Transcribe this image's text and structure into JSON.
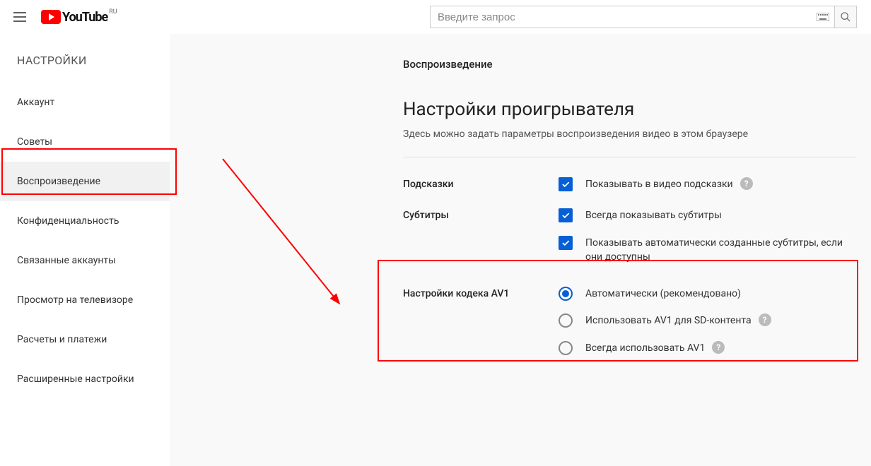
{
  "header": {
    "logo_text": "YouTube",
    "logo_region": "RU",
    "search_placeholder": "Введите запрос"
  },
  "sidebar": {
    "title": "НАСТРОЙКИ",
    "items": [
      "Аккаунт",
      "Советы",
      "Воспроизведение",
      "Конфиденциальность",
      "Связанные аккаунты",
      "Просмотр на телевизоре",
      "Расчеты и платежи",
      "Расширенные настройки"
    ],
    "active_index": 2
  },
  "content": {
    "breadcrumb": "Воспроизведение",
    "heading": "Настройки проигрывателя",
    "subheading": "Здесь можно задать параметры воспроизведения видео в этом браузере",
    "sections": {
      "hints": {
        "label": "Подсказки",
        "options": [
          {
            "text": "Показывать в видео подсказки",
            "help": true
          }
        ]
      },
      "subs": {
        "label": "Субтитры",
        "options": [
          {
            "text": "Всегда показывать субтитры"
          },
          {
            "text": "Показывать автоматически созданные субтитры, если они доступны"
          }
        ]
      },
      "av1": {
        "label": "Настройки кодека AV1",
        "options": [
          {
            "text": "Автоматически (рекомендовано)",
            "selected": true
          },
          {
            "text": "Использовать AV1 для SD-контента",
            "help": true
          },
          {
            "text": "Всегда использовать AV1",
            "help": true
          }
        ]
      }
    }
  }
}
